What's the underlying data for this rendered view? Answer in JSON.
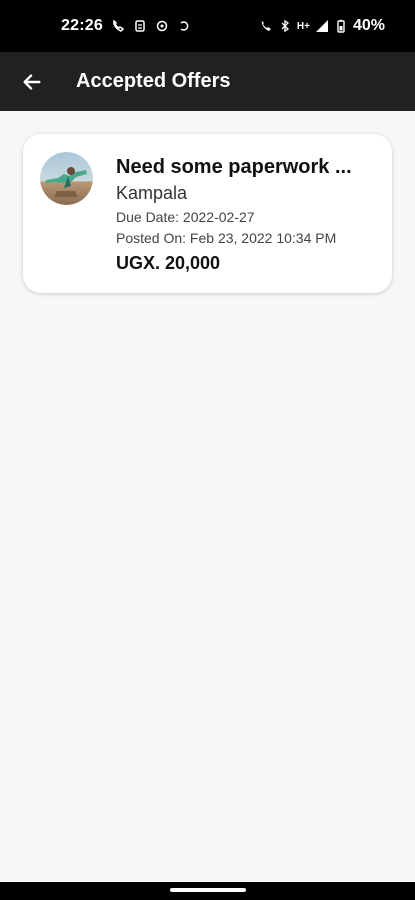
{
  "status_bar": {
    "time": "22:26",
    "battery": "40%",
    "network": "H+",
    "icons_left": [
      "call-forward-icon",
      "sim-status-icon",
      "mail-icon",
      "sync-icon"
    ],
    "icons_right": [
      "call-icon",
      "bluetooth-icon",
      "signal-icon",
      "battery-icon"
    ]
  },
  "app_bar": {
    "back_icon": "arrow-left-icon",
    "title": "Accepted Offers"
  },
  "offers": [
    {
      "title": "Need some paperwork ...",
      "location": "Kampala",
      "due_date": "Due Date: 2022-02-27",
      "posted_on": "Posted On: Feb 23, 2022 10:34 PM",
      "price": "UGX. 20,000"
    }
  ],
  "colors": {
    "status_bar_bg": "#000000",
    "app_bar_bg": "#212121",
    "page_bg": "#f7f7f7",
    "card_bg": "#ffffff"
  }
}
